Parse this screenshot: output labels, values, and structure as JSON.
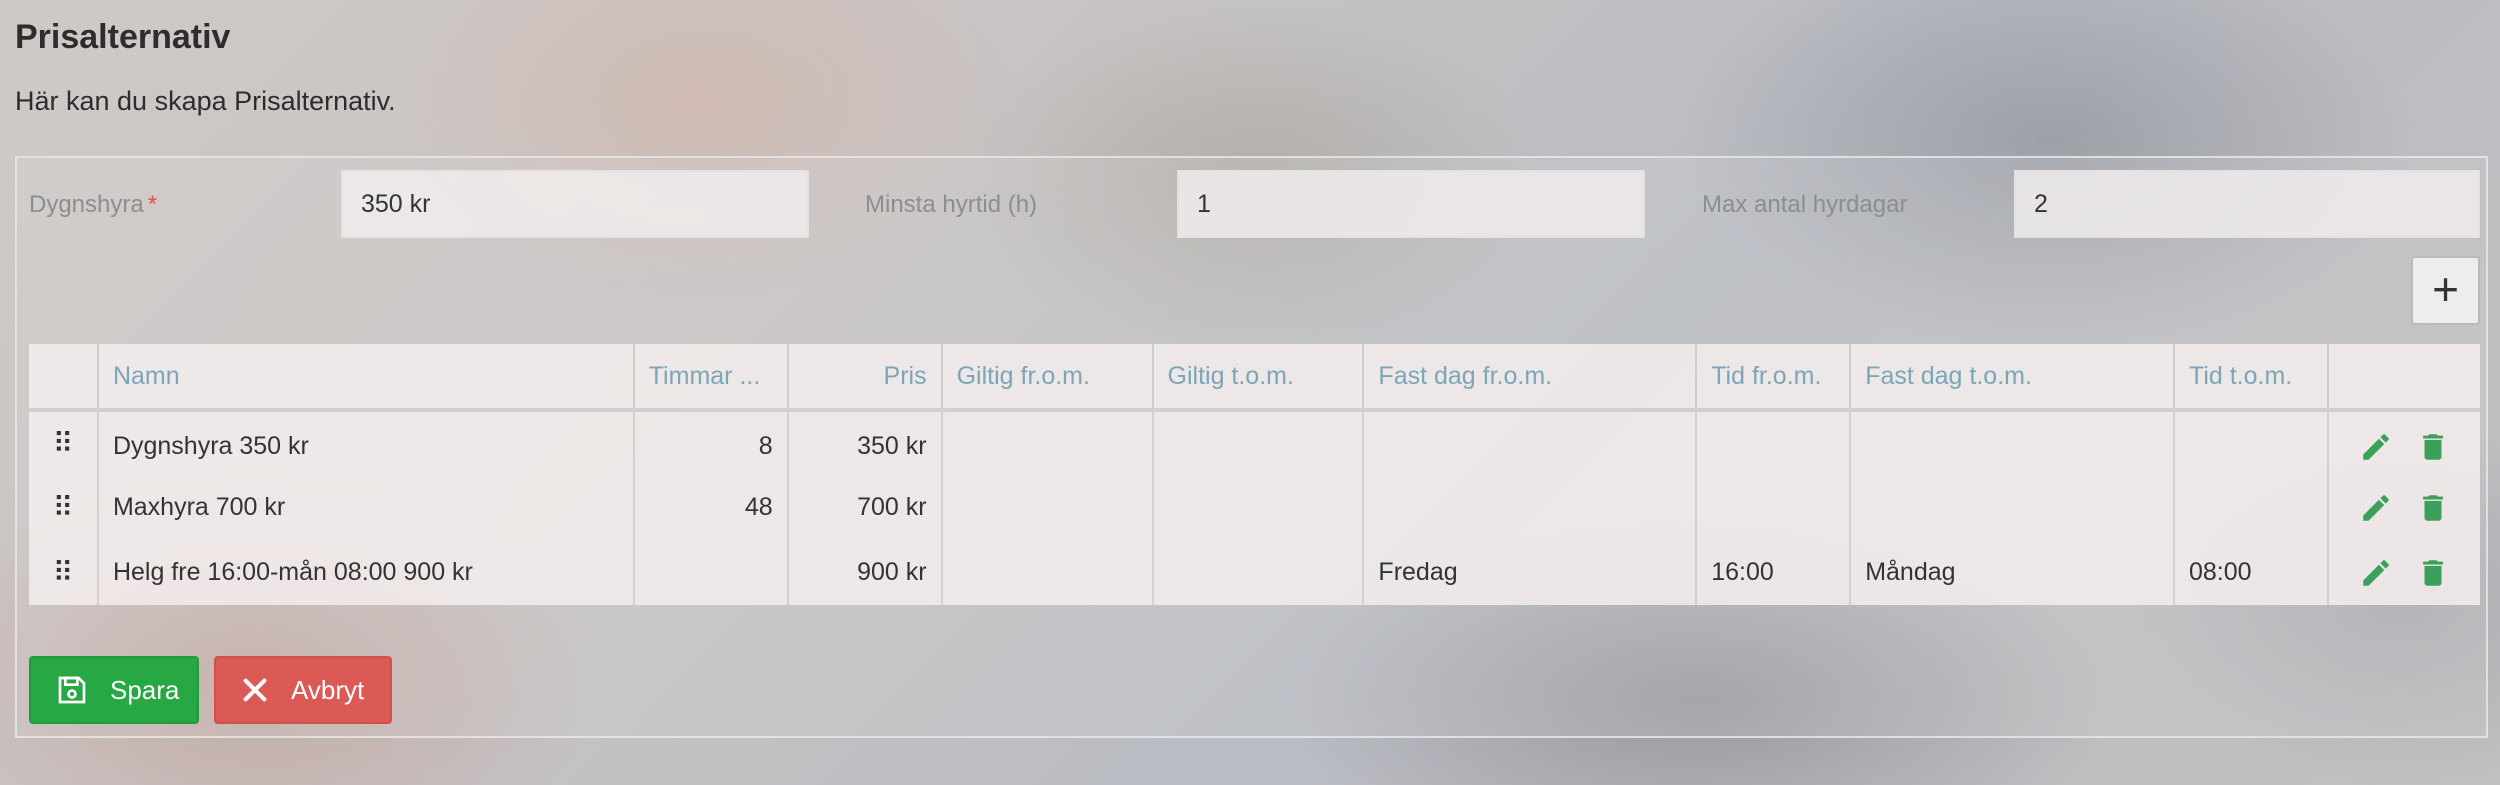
{
  "page": {
    "title": "Prisalternativ",
    "subtitle": "Här kan du skapa Prisalternativ."
  },
  "form": {
    "dygnshyra_label": "Dygnshyra",
    "required_mark": "*",
    "dygnshyra_value": "350 kr",
    "minsta_label": "Minsta hyrtid (h)",
    "minsta_value": "1",
    "max_label": "Max antal hyrdagar",
    "max_value": "2",
    "add_label": "+"
  },
  "table": {
    "headers": [
      "Namn",
      "Timmar ...",
      "Pris",
      "Giltig fr.o.m.",
      "Giltig t.o.m.",
      "Fast dag fr.o.m.",
      "Tid fr.o.m.",
      "Fast dag t.o.m.",
      "Tid t.o.m."
    ],
    "rows": [
      {
        "name": "Dygnshyra 350 kr",
        "hours": "8",
        "price": "350 kr",
        "valid_from": "",
        "valid_to": "",
        "day_from": "",
        "time_from": "",
        "day_to": "",
        "time_to": ""
      },
      {
        "name": "Maxhyra 700 kr",
        "hours": "48",
        "price": "700 kr",
        "valid_from": "",
        "valid_to": "",
        "day_from": "",
        "time_from": "",
        "day_to": "",
        "time_to": ""
      },
      {
        "name": "Helg fre 16:00-mån 08:00 900 kr",
        "hours": "",
        "price": "900 kr",
        "valid_from": "",
        "valid_to": "",
        "day_from": "Fredag",
        "time_from": "16:00",
        "day_to": "Måndag",
        "time_to": "08:00"
      }
    ],
    "drag_glyph": "⠿"
  },
  "buttons": {
    "save_label": "Spara",
    "cancel_label": "Avbryt"
  },
  "colors": {
    "save": "#28a745",
    "cancel": "#dc5a55",
    "edit_icon": "#3aa05a",
    "delete_icon": "#3aa05a",
    "header_text": "#7aa6b8"
  }
}
